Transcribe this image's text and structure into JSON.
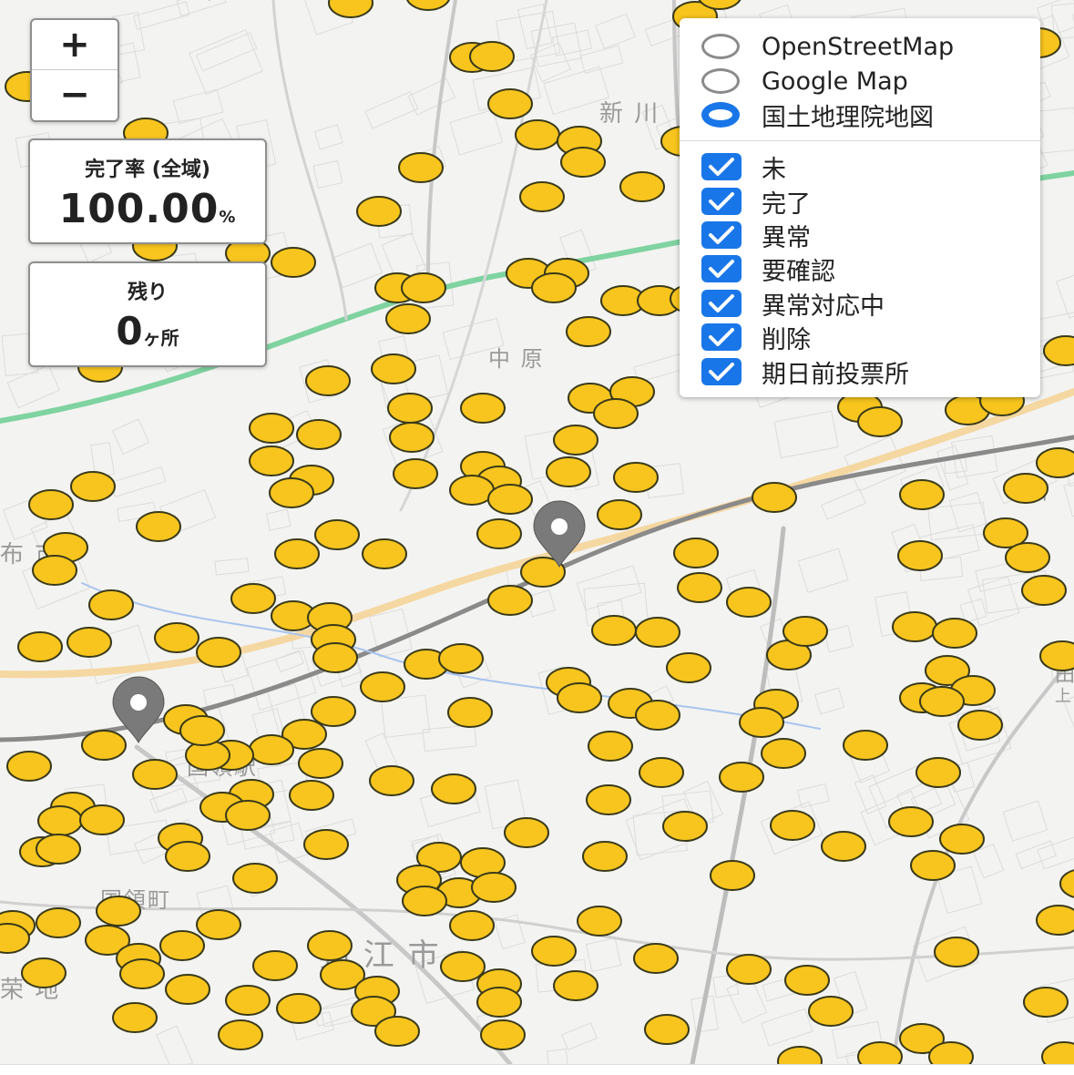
{
  "map": {
    "place_labels": [
      {
        "text": "新 川",
        "name": "label-shinkawa"
      },
      {
        "text": "中 原",
        "name": "label-nakahara"
      },
      {
        "text": "国領町",
        "name": "label-kokuryo"
      },
      {
        "text": "狛 江 市",
        "name": "label-komae"
      },
      {
        "text": "布 市",
        "name": "label-fushi"
      },
      {
        "text": "国領駅",
        "name": "label-kokuryo-station"
      },
      {
        "text": "田",
        "name": "label-ta"
      },
      {
        "text": "川",
        "name": "label-kawa"
      },
      {
        "text": "上",
        "name": "label-ue"
      },
      {
        "text": "荣 地",
        "name": "label-eichi"
      }
    ],
    "marker_color": "#f7c51e",
    "marker_border": "#3a3a1a",
    "pin_color": "#7a7a7a"
  },
  "zoom": {
    "in_label": "+",
    "out_label": "−"
  },
  "completion": {
    "label": "完了率 (全域)",
    "value": "100.00",
    "unit": "%"
  },
  "remaining": {
    "label": "残り",
    "value": "0",
    "unit": "ヶ所"
  },
  "layers": {
    "base_maps": [
      {
        "label": "OpenStreetMap",
        "selected": false
      },
      {
        "label": "Google Map",
        "selected": false
      },
      {
        "label": "国土地理院地図",
        "selected": true
      }
    ],
    "filters": [
      {
        "label": "未",
        "checked": true
      },
      {
        "label": "完了",
        "checked": true
      },
      {
        "label": "異常",
        "checked": true
      },
      {
        "label": "要確認",
        "checked": true
      },
      {
        "label": "異常対応中",
        "checked": true
      },
      {
        "label": "削除",
        "checked": true
      },
      {
        "label": "期日前投票所",
        "checked": true
      }
    ],
    "accent_color": "#1976e8"
  }
}
